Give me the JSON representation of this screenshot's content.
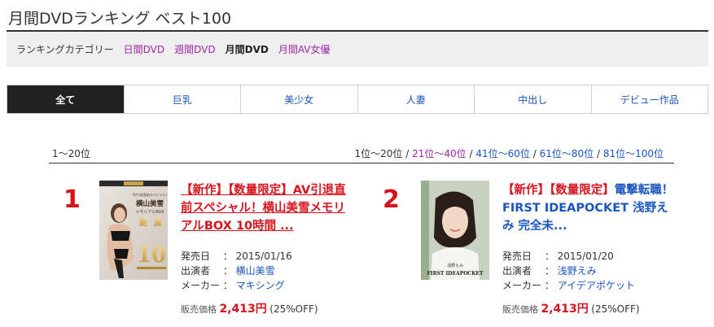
{
  "page": {
    "title": "月間DVDランキング ベスト100"
  },
  "categories": {
    "label": "ランキングカテゴリー",
    "items": [
      "日間DVD",
      "週間DVD",
      "月間DVD",
      "月間AV女優"
    ],
    "active": "月間DVD"
  },
  "genres": {
    "items": [
      "全て",
      "巨乳",
      "美少女",
      "人妻",
      "中出し",
      "デビュー作品"
    ],
    "active": "全て"
  },
  "ranges": {
    "current_label": "1〜20位",
    "links": [
      "1位〜20位",
      "21位〜40位",
      "41位〜60位",
      "61位〜80位",
      "81位〜100位"
    ],
    "separator": " / "
  },
  "items": [
    {
      "rank": "1",
      "title": "【新作】【数量限定】AV引退直前スペシャル！横山美雪メモリアルBOX 10時間 ...",
      "release_label": "発売日",
      "release_date": "2015/01/16",
      "performer_label": "出演者",
      "performer": "横山美雪",
      "maker_label": "メーカー",
      "maker": "マキシング",
      "price_label": "販売価格",
      "price": "2,413円",
      "discount": "(25%OFF)",
      "cover_text": [
        "AV引退直前スペシャル!",
        "横山美雪",
        "メモリアルBOX",
        "艶",
        "麗",
        "10"
      ]
    },
    {
      "rank": "2",
      "title_new": "【新作】【数量限定】",
      "title_rest": "電撃転職！FIRST IDEAPOCKET 浅野えみ 完全未...",
      "release_label": "発売日",
      "release_date": "2015/01/20",
      "performer_label": "出演者",
      "performer": "浅野えみ",
      "maker_label": "メーカー",
      "maker": "アイデアポケット",
      "price_label": "販売価格",
      "price": "2,413円",
      "discount": "(25%OFF)",
      "cover_text": [
        "浅野えみ",
        "FIRST IDEAPOCKET"
      ]
    }
  ],
  "colors": {
    "accent_red": "#d7141c",
    "link_blue": "#1a55c2",
    "visited_purple": "#9c27a8",
    "tab_active_bg": "#222222"
  }
}
